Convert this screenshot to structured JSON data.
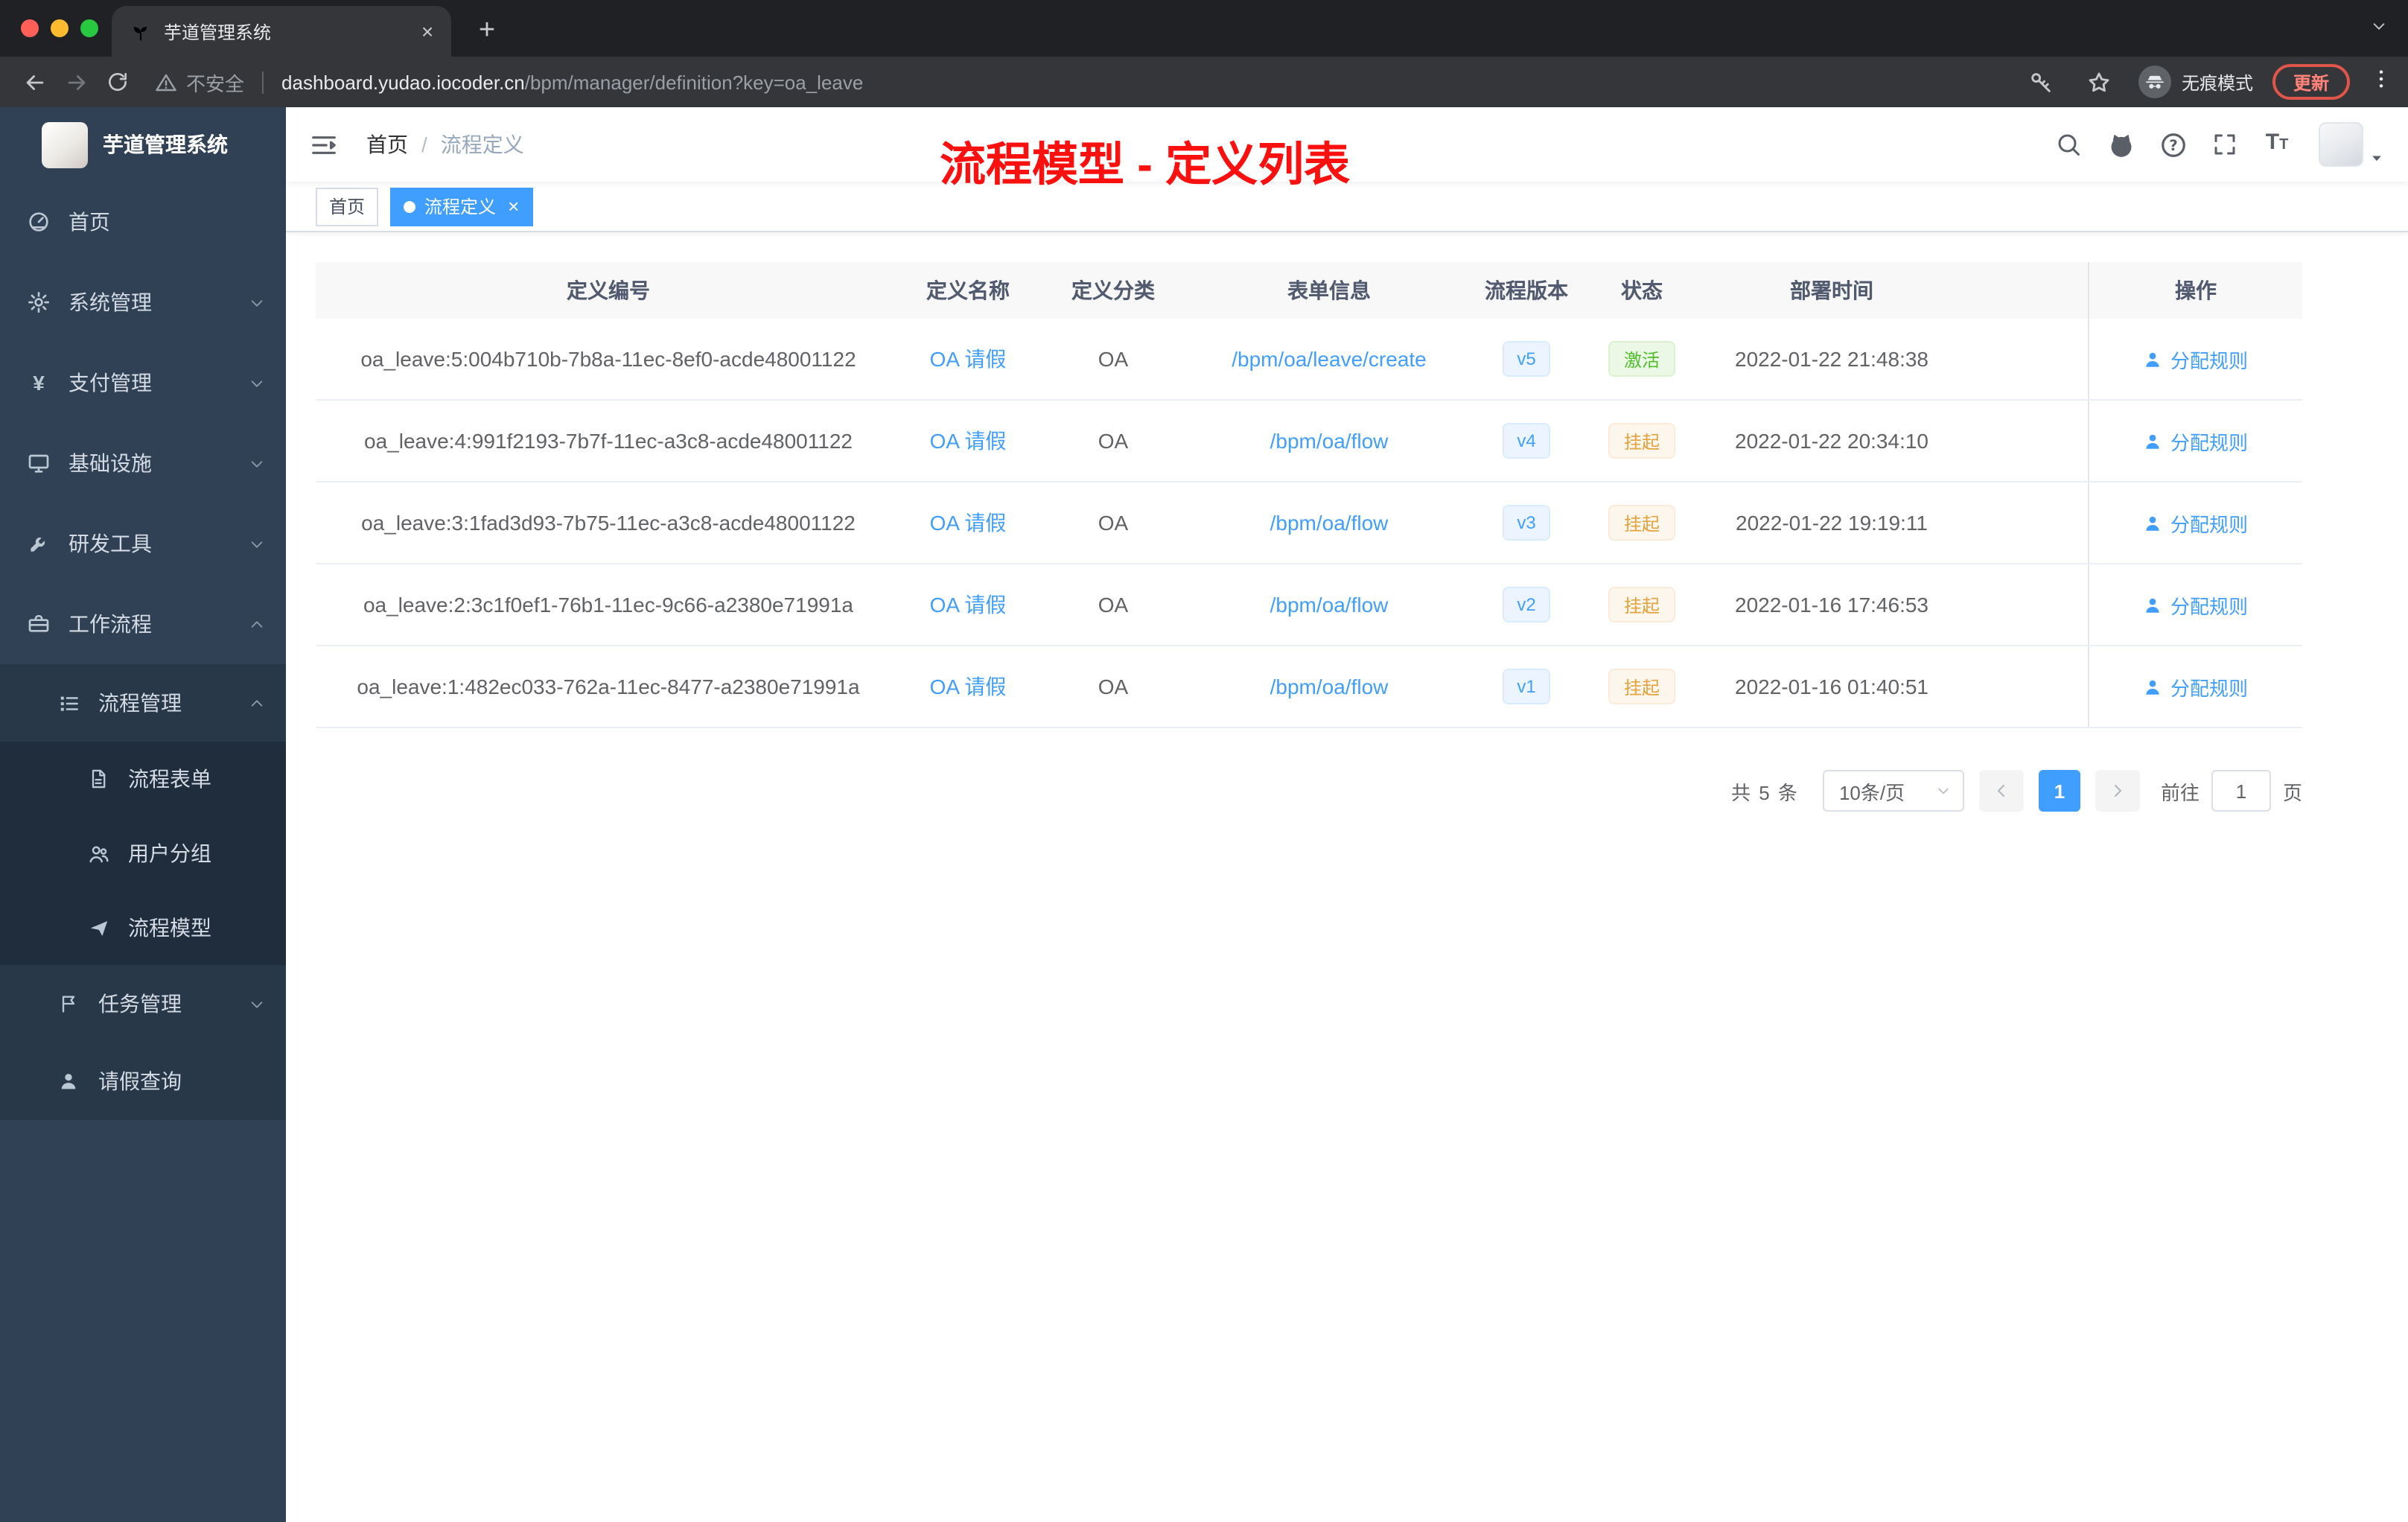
{
  "browser": {
    "tab_title": "芋道管理系统",
    "security_label": "不安全",
    "url_host": "dashboard.yudao.iocoder.cn",
    "url_path": "/bpm/manager/definition?key=oa_leave",
    "incognito_label": "无痕模式",
    "update_label": "更新"
  },
  "glyphs": {
    "close": "×",
    "plus": "+",
    "breadcrumb_separator": "/",
    "yen": "¥",
    "font_size_large": "T",
    "font_size_small": "T"
  },
  "icons": {
    "tab_favicon": "sprout-icon",
    "security": "warning-triangle-icon",
    "toolbar_right": [
      "key-icon",
      "star-icon",
      "incognito-icon",
      "more-vertical-icon"
    ],
    "navbar_right": [
      "search-icon",
      "github-icon",
      "help-icon",
      "fullscreen-icon",
      "font-size-icon"
    ],
    "action_link": "user-icon"
  },
  "sidebar": {
    "logo_title": "芋道管理系统",
    "items": [
      {
        "label": "首页",
        "icon": "dashboard-icon",
        "level": 1
      },
      {
        "label": "系统管理",
        "icon": "gear-icon",
        "level": 1,
        "chevron": "down"
      },
      {
        "label": "支付管理",
        "icon": "yen-icon",
        "level": 1,
        "chevron": "down"
      },
      {
        "label": "基础设施",
        "icon": "monitor-icon",
        "level": 1,
        "chevron": "down"
      },
      {
        "label": "研发工具",
        "icon": "wrench-icon",
        "level": 1,
        "chevron": "down"
      },
      {
        "label": "工作流程",
        "icon": "briefcase-icon",
        "level": 1,
        "chevron": "up"
      },
      {
        "label": "流程管理",
        "icon": "tree-list-icon",
        "level": 2,
        "chevron": "up"
      },
      {
        "label": "流程表单",
        "icon": "document-icon",
        "level": 3
      },
      {
        "label": "用户分组",
        "icon": "user-group-icon",
        "level": 3
      },
      {
        "label": "流程模型",
        "icon": "paper-plane-icon",
        "level": 3
      },
      {
        "label": "任务管理",
        "icon": "flag-icon",
        "level": 2,
        "chevron": "down"
      },
      {
        "label": "请假查询",
        "icon": "person-icon",
        "level": 2
      }
    ]
  },
  "navbar": {
    "breadcrumb": [
      "首页",
      "流程定义"
    ],
    "annotation": "流程模型 - 定义列表"
  },
  "tags": [
    {
      "label": "首页",
      "active": false
    },
    {
      "label": "流程定义",
      "active": true
    }
  ],
  "table": {
    "columns": [
      "定义编号",
      "定义名称",
      "定义分类",
      "表单信息",
      "流程版本",
      "状态",
      "部署时间",
      "操作"
    ],
    "rows": [
      {
        "id": "oa_leave:5:004b710b-7b8a-11ec-8ef0-acde48001122",
        "name": "OA 请假",
        "category": "OA",
        "form": "/bpm/oa/leave/create",
        "version": "v5",
        "status": "激活",
        "status_type": "success",
        "deployed": "2022-01-22 21:48:38",
        "action": "分配规则"
      },
      {
        "id": "oa_leave:4:991f2193-7b7f-11ec-a3c8-acde48001122",
        "name": "OA 请假",
        "category": "OA",
        "form": "/bpm/oa/flow",
        "version": "v4",
        "status": "挂起",
        "status_type": "warning",
        "deployed": "2022-01-22 20:34:10",
        "action": "分配规则"
      },
      {
        "id": "oa_leave:3:1fad3d93-7b75-11ec-a3c8-acde48001122",
        "name": "OA 请假",
        "category": "OA",
        "form": "/bpm/oa/flow",
        "version": "v3",
        "status": "挂起",
        "status_type": "warning",
        "deployed": "2022-01-22 19:19:11",
        "action": "分配规则"
      },
      {
        "id": "oa_leave:2:3c1f0ef1-76b1-11ec-9c66-a2380e71991a",
        "name": "OA 请假",
        "category": "OA",
        "form": "/bpm/oa/flow",
        "version": "v2",
        "status": "挂起",
        "status_type": "warning",
        "deployed": "2022-01-16 17:46:53",
        "action": "分配规则"
      },
      {
        "id": "oa_leave:1:482ec033-762a-11ec-8477-a2380e71991a",
        "name": "OA 请假",
        "category": "OA",
        "form": "/bpm/oa/flow",
        "version": "v1",
        "status": "挂起",
        "status_type": "warning",
        "deployed": "2022-01-16 01:40:51",
        "action": "分配规则"
      }
    ]
  },
  "pagination": {
    "total": "共 5 条",
    "page_size": "10条/页",
    "current_page": "1",
    "goto_label": "前往",
    "goto_value": "1",
    "page_unit": "页"
  },
  "colors": {
    "accent": "#409eff",
    "success": "#4fbe29",
    "warning": "#e6a23c",
    "annotation": "#fb1010",
    "sidebar_bg": "#304156"
  }
}
